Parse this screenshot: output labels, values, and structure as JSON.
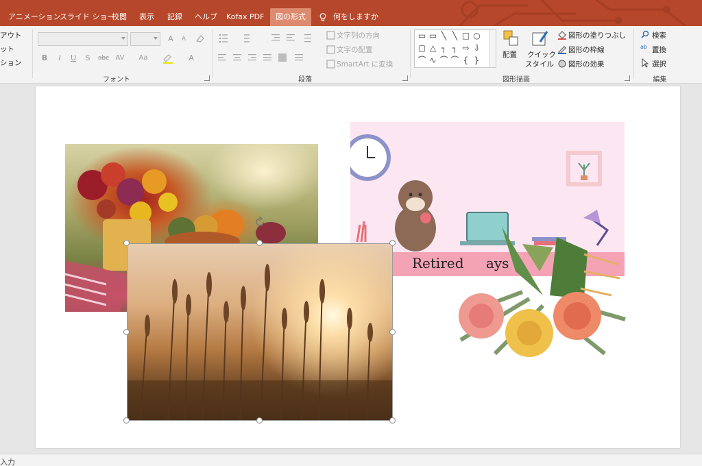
{
  "tabs": [
    {
      "label": "アニメーション",
      "active": false
    },
    {
      "label": "スライド ショー",
      "active": false
    },
    {
      "label": "校閲",
      "active": false
    },
    {
      "label": "表示",
      "active": false
    },
    {
      "label": "記録",
      "active": false
    },
    {
      "label": "ヘルプ",
      "active": false
    },
    {
      "label": "Kofax PDF",
      "active": false
    },
    {
      "label": "図の形式",
      "active": true
    }
  ],
  "tell_me": "何をしますか",
  "ribbon": {
    "left_cut": {
      "item1": "アウト",
      "item2": "ット",
      "item3": "ション"
    },
    "font": {
      "label": "フォント",
      "bold": "B",
      "italic": "I",
      "underline": "U",
      "shadow": "S",
      "strike": "abc",
      "spacing": "AV",
      "case": "Aa",
      "grow": "A",
      "shrink": "A",
      "color": "A"
    },
    "paragraph": {
      "label": "段落",
      "text_direction": "文字列の方向",
      "align_text": "文字の配置",
      "smartart": "SmartArt に変換"
    },
    "drawing": {
      "label": "図形描画",
      "arrange": "配置",
      "quick_styles_line1": "クイック",
      "quick_styles_line2": "スタイル",
      "shape_fill": "図形の塗りつぶし",
      "shape_outline": "図形の枠線",
      "shape_effects": "図形の効果"
    },
    "editing": {
      "label": "編集",
      "find": "検索",
      "replace": "置換",
      "select": "選択"
    }
  },
  "slide": {
    "retired_text": "Retired",
    "retired_text_cut": "ays"
  },
  "status_bar": {
    "text": "入力"
  },
  "colors": {
    "title_bar": "#b7472a",
    "active_tab": "#dd8a6f",
    "ribbon_bg": "#f3f3f3",
    "retired_bg": "#fbe6f1",
    "retired_banner": "#f4a3b5"
  }
}
